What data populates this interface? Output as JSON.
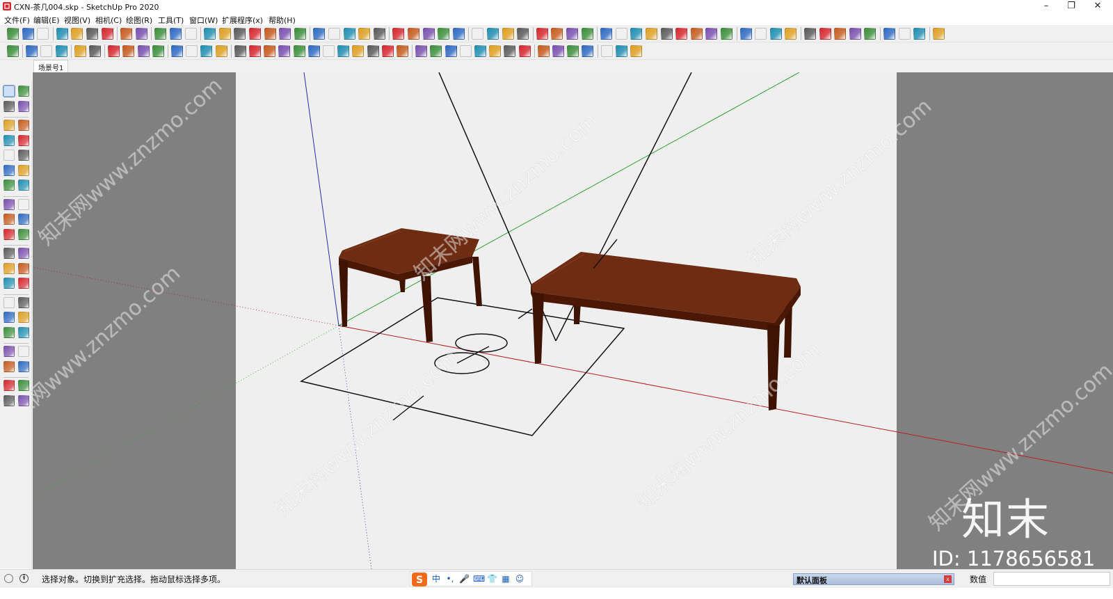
{
  "window": {
    "title": "CXN-茶几004.skp - SketchUp Pro 2020",
    "minimize_glyph": "–",
    "maximize_glyph": "❐",
    "close_glyph": "✕"
  },
  "menu": {
    "items": [
      "文件(F)",
      "编辑(E)",
      "视图(V)",
      "相机(C)",
      "绘图(R)",
      "工具(T)",
      "窗口(W)",
      "扩展程序(x)",
      "帮助(H)"
    ]
  },
  "toolbar": {
    "row1_icons": [
      "new-model-icon",
      "open-icon",
      "save-icon",
      "cut-icon",
      "copy-icon",
      "paste-icon",
      "erase-icon",
      "undo-icon",
      "redo-icon",
      "print-icon",
      "model-info-icon",
      "xray-icon",
      "back-edges-icon",
      "wireframe-icon",
      "hidden-line-icon",
      "shaded-icon",
      "shaded-textures-icon",
      "monochrome-icon",
      "iso-view-icon",
      "top-view-icon",
      "front-view-icon",
      "right-view-icon",
      "back-view-icon",
      "left-view-icon",
      "component-icon",
      "group-icon",
      "make-component-icon",
      "solid-union-icon",
      "solid-subtract-icon",
      "solid-intersect-icon",
      "solid-trim-icon",
      "solid-split-icon",
      "sandbox-contours-icon",
      "sandbox-scratch-icon",
      "sandbox-smoove-icon",
      "sandbox-stamp-icon",
      "sandbox-drape-icon",
      "section-plane-icon",
      "section-display-icon",
      "section-cut-icon",
      "axes-icon",
      "tape-measure-icon",
      "protractor-icon",
      "text-icon",
      "dimension-icon",
      "3d-text-icon",
      "extension-warehouse-icon",
      "3d-warehouse-icon",
      "layout-icon",
      "style-builder-icon",
      "add-location-icon",
      "terrain-icon",
      "photo-texture-icon",
      "preview-icon",
      "upload-icon",
      "settings-icon",
      "mail-icon",
      "info-icon",
      "user-icon"
    ],
    "row2_icons": [
      "select-row2-icon",
      "paint-row2-icon",
      "lasso-icon",
      "cloud-icon",
      "align-icon",
      "distribute-icon",
      "frame-icon",
      "frame-2-icon",
      "frame-3-icon",
      "lock-icon",
      "stairs-icon",
      "column-icon",
      "beam-icon",
      "bar-chart-icon",
      "path-tool-1-icon",
      "path-tool-2-icon",
      "path-tool-3-icon",
      "path-tool-4-icon",
      "path-tool-5-icon",
      "path-tool-6-icon",
      "path-tool-7-icon",
      "path-tool-8-icon",
      "path-tool-9-icon",
      "path-tool-10-icon",
      "path-tool-11-icon",
      "path-tool-12-icon",
      "arc-path-icon",
      "wave-1-icon",
      "wave-2-icon",
      "curve-icon",
      "spiral-icon",
      "fence-icon",
      "railing-icon",
      "pillar-icon",
      "grid-icon",
      "dots-icon",
      "book-icon",
      "brush-icon",
      "brush-2-icon",
      "frame-export-icon",
      "render-icon"
    ]
  },
  "scene_tab": {
    "label": "场景号1"
  },
  "left_toolbar": {
    "icons": [
      "select-icon",
      "make-component-left-icon",
      "paint-bucket-icon",
      "eraser-icon",
      "line-icon",
      "freehand-icon",
      "rectangle-icon",
      "rotated-rectangle-icon",
      "circle-icon",
      "polygon-icon",
      "arc-icon",
      "two-point-arc-icon",
      "three-point-arc-icon",
      "pie-icon",
      "move-icon",
      "push-pull-icon",
      "rotate-icon",
      "follow-me-icon",
      "scale-icon",
      "offset-icon",
      "tape-measure-left-icon",
      "dimension-left-icon",
      "protractor-left-icon",
      "text-left-icon",
      "axes-left-icon",
      "3d-text-left-icon",
      "orbit-icon",
      "pan-icon",
      "zoom-icon",
      "zoom-window-icon",
      "zoom-extents-icon",
      "previous-view-icon",
      "position-camera-icon",
      "look-around-icon",
      "walk-icon",
      "section-plane-left-icon",
      "warehouse-left-icon",
      "extension-left-icon",
      "ruby-icon",
      "ruby-2-icon"
    ]
  },
  "viewport": {
    "colors": {
      "background": "#808080",
      "canvas": "#efefef",
      "wood_top": "#6e2c12",
      "wood_side": "#4b1806",
      "wood_leg": "#3f1303",
      "red_axis": "#b32020",
      "green_axis": "#2fa12f",
      "blue_axis": "#2a2aa8"
    },
    "watermark_text": "知末网www.znzmo.com"
  },
  "branding": {
    "logo_text": "知末",
    "id_text": "ID: 1178656581"
  },
  "statusbar": {
    "hint": "选择对象。切换到扩充选择。拖动鼠标选择多项。",
    "ime_icons": [
      "中",
      "•,",
      "🎤",
      "⌨",
      "👕",
      "▦",
      "☺"
    ],
    "default_panel_label": "默认面板",
    "default_panel_close": "x",
    "measurement_label": "数值",
    "measurement_value": ""
  }
}
